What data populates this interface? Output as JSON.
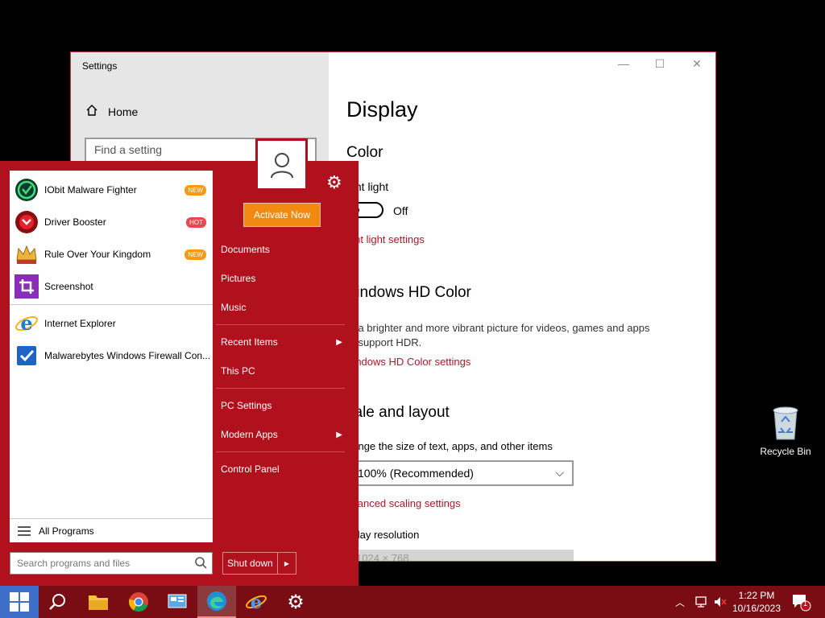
{
  "desktop": {
    "recycle_bin": "Recycle Bin"
  },
  "settings": {
    "window_title": "Settings",
    "home": "Home",
    "find_placeholder": "Find a setting",
    "page_title": "Display",
    "color_heading": "Color",
    "night_light_label": "ight light",
    "night_light_state": "Off",
    "night_light_link": "ight light settings",
    "hd_heading": "Vindows HD Color",
    "hd_desc_line1": "et a brighter and more vibrant picture for videos, games and apps",
    "hd_desc_line2": "at support HDR.",
    "hd_link": "Vindows HD Color settings",
    "scale_heading": "cale and layout",
    "scale_desc": "hange the size of text, apps, and other items",
    "scale_value": "100% (Recommended)",
    "advanced_link": "dvanced scaling settings",
    "resolution_label": "splay resolution",
    "resolution_value": "1024 × 768"
  },
  "start_menu": {
    "apps": [
      {
        "label": "IObit Malware Fighter",
        "badge": "NEW",
        "icon": "iobit-shield-icon"
      },
      {
        "label": "Driver Booster",
        "badge": "HOT",
        "icon": "driver-booster-icon"
      },
      {
        "label": "Rule Over Your Kingdom",
        "badge": "NEW",
        "icon": "kingdom-crown-icon"
      },
      {
        "label": "Screenshot",
        "badge": "",
        "icon": "crop-icon"
      },
      {
        "label": "Internet Explorer",
        "badge": "",
        "icon": "internet-explorer-icon"
      },
      {
        "label": "Malwarebytes Windows Firewall Con...",
        "badge": "",
        "icon": "checkmark-icon"
      }
    ],
    "all_programs": "All Programs",
    "search_placeholder": "Search programs and files",
    "shutdown": "Shut down",
    "activate": "Activate Now",
    "right_items": {
      "documents": "Documents",
      "pictures": "Pictures",
      "music": "Music",
      "recent": "Recent Items",
      "this_pc": "This PC",
      "pc_settings": "PC Settings",
      "modern_apps": "Modern Apps",
      "control_panel": "Control Panel"
    }
  },
  "taskbar": {
    "time": "1:22 PM",
    "date": "10/16/2023",
    "notification_count": "1"
  },
  "colors": {
    "start_bg": "#b1111d",
    "taskbar_bg": "#7a0d14",
    "accent_link": "#b8122a",
    "activate_bg": "#f28a12"
  }
}
